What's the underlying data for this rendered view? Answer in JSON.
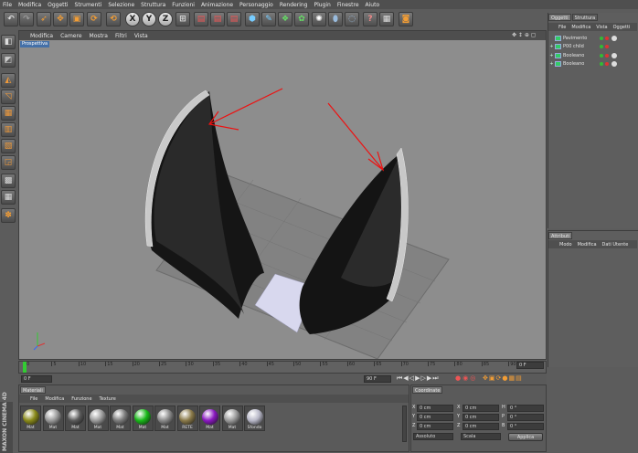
{
  "menubar": [
    "File",
    "Modifica",
    "Oggetti",
    "Strumenti",
    "Selezione",
    "Struttura",
    "Funzioni",
    "Animazione",
    "Personaggio",
    "Rendering",
    "Plugin",
    "Finestre",
    "Aiuto"
  ],
  "toolbar": {
    "axis_x": "X",
    "axis_y": "Y",
    "axis_z": "Z"
  },
  "viewport": {
    "menu": [
      "Modifica",
      "Camere",
      "Mostra",
      "Filtri",
      "Vista"
    ],
    "label": "Prospettiva",
    "nav_icons": "✥ ↕ ⊕ ▢"
  },
  "object_manager": {
    "tabs": [
      "Oggetti",
      "Struttura"
    ],
    "menu": [
      "File",
      "Modifica",
      "Vista",
      "Oggetti"
    ],
    "rows": [
      {
        "name": "Pavimento",
        "expander": ""
      },
      {
        "name": "P00 child",
        "expander": "+"
      },
      {
        "name": "Booleano",
        "expander": "+"
      },
      {
        "name": "Booleano",
        "expander": "+"
      }
    ]
  },
  "attributes": {
    "tab": "Attributi",
    "menu": [
      "Modo",
      "Modifica",
      "Dati Utente"
    ]
  },
  "timeline": {
    "ticks": [
      "0",
      "5",
      "10",
      "15",
      "20",
      "25",
      "30",
      "35",
      "40",
      "45",
      "50",
      "55",
      "60",
      "65",
      "70",
      "75",
      "80",
      "85",
      "90"
    ],
    "current_frame": "0 F"
  },
  "transport": {
    "start_field": "0 F",
    "end_field": "90 F",
    "fps_field": "0 F"
  },
  "materials": {
    "tab": "Materiali",
    "menu": [
      "File",
      "Modifica",
      "Funzione",
      "Texture"
    ],
    "swatches": [
      {
        "label": "Mat",
        "color": "#8a8a1a"
      },
      {
        "label": "Mat",
        "color": "#9a9a9a"
      },
      {
        "label": "Mat",
        "color": "#5a5a5a"
      },
      {
        "label": "Mat",
        "color": "#9c9c9c"
      },
      {
        "label": "Mat",
        "color": "#7c7c7c"
      },
      {
        "label": "Mat",
        "color": "#18b818"
      },
      {
        "label": "Mat",
        "color": "#8a8a8a"
      },
      {
        "label": "RETE",
        "color": "#8a7a4a"
      },
      {
        "label": "Mat",
        "color": "#8a18c0"
      },
      {
        "label": "Mat",
        "color": "#9a9a9a"
      },
      {
        "label": "Sfondo",
        "color": "#b8b8c8"
      }
    ]
  },
  "coordinates": {
    "tab": "Coordinate",
    "rows": [
      {
        "axis": "X",
        "pos": "0 cm",
        "size_axis": "X",
        "size": "0 cm",
        "rot_axis": "H",
        "rot": "0 °"
      },
      {
        "axis": "Y",
        "pos": "0 cm",
        "size_axis": "Y",
        "size": "0 cm",
        "rot_axis": "P",
        "rot": "0 °"
      },
      {
        "axis": "Z",
        "pos": "0 cm",
        "size_axis": "Z",
        "size": "0 cm",
        "rot_axis": "B",
        "rot": "0 °"
      }
    ],
    "mode1": "Assoluto",
    "mode2": "Scala",
    "apply": "Applica"
  },
  "logo": "MAXON CINEMA 4D"
}
